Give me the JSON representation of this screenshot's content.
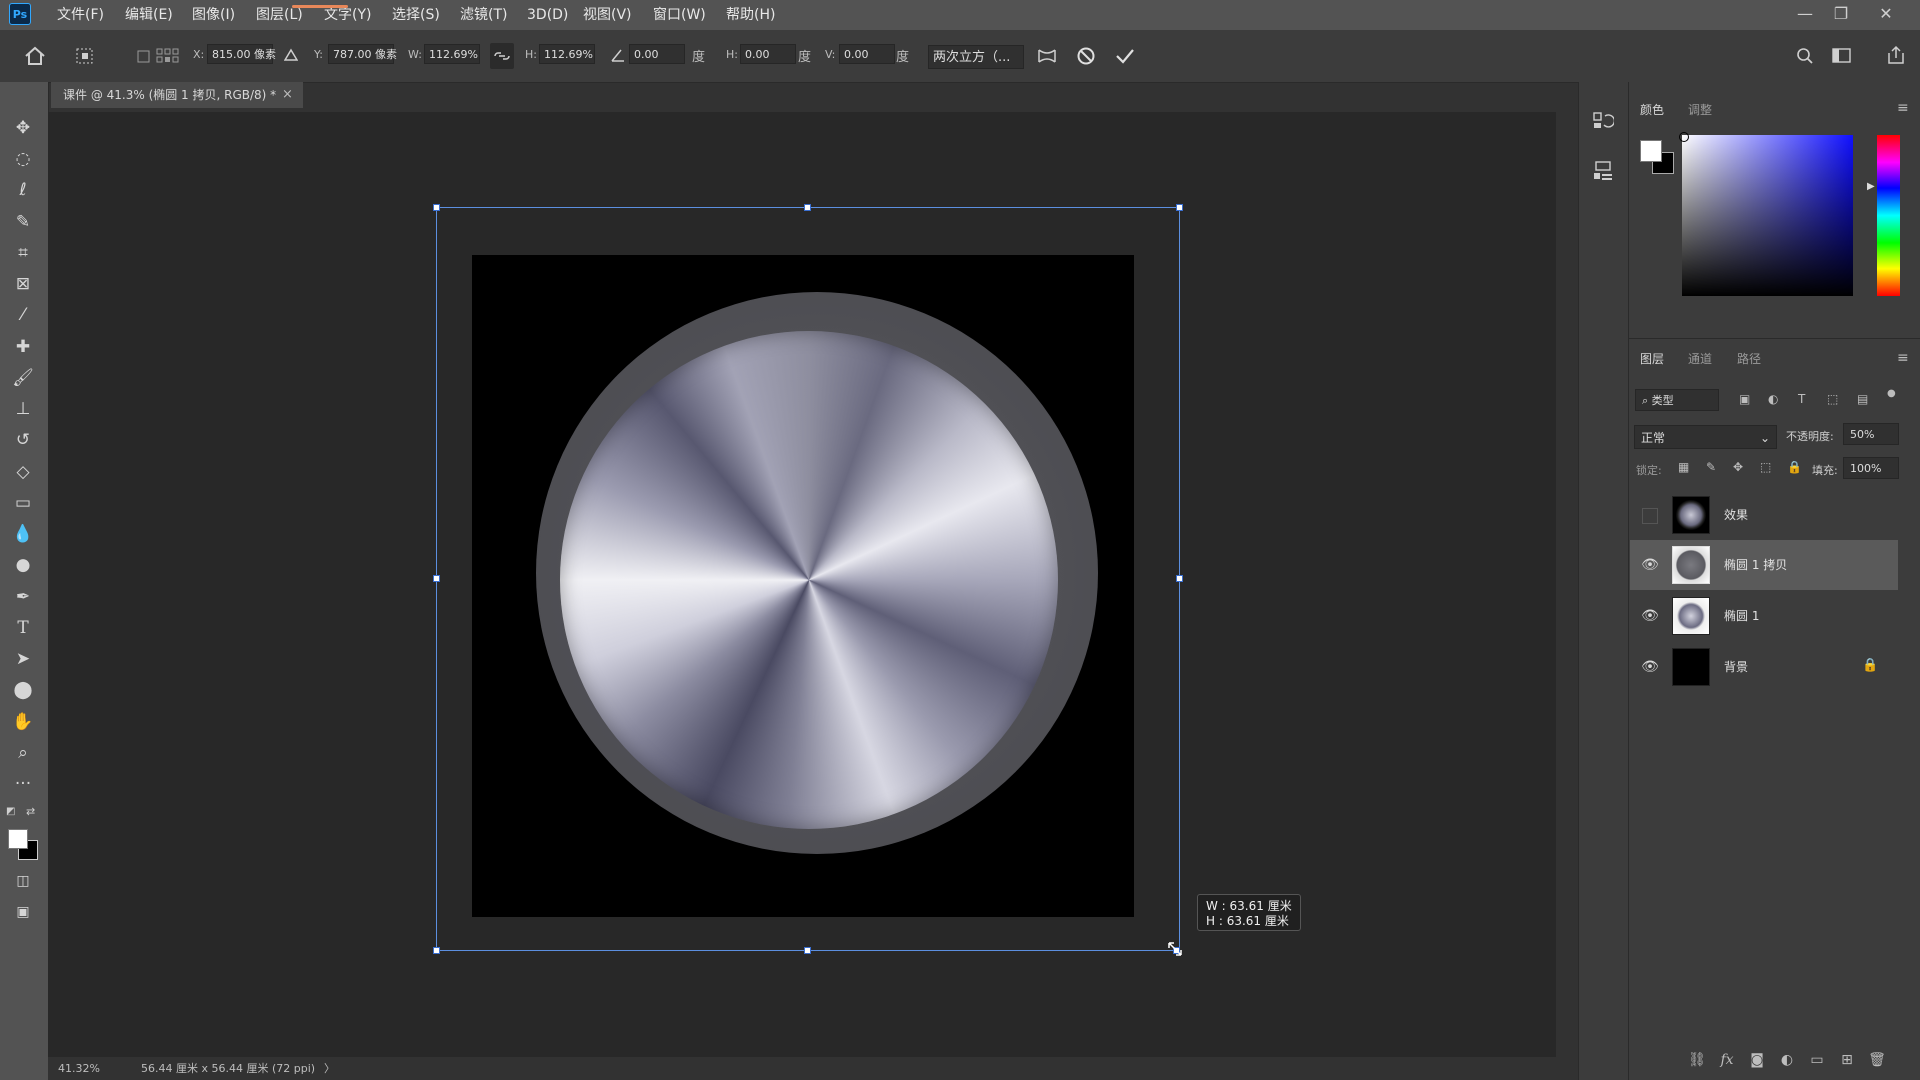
{
  "app": {
    "logo": "Ps"
  },
  "menu": [
    "文件(F)",
    "编辑(E)",
    "图像(I)",
    "图层(L)",
    "文字(Y)",
    "选择(S)",
    "滤镜(T)",
    "3D(D)",
    "视图(V)",
    "窗口(W)",
    "帮助(H)"
  ],
  "window_controls": {
    "minimize": "—",
    "restore": "❐",
    "close": "✕"
  },
  "options": {
    "x_label": "X:",
    "x_value": "815.00 像素",
    "y_label": "Y:",
    "y_value": "787.00 像素",
    "w_label": "W:",
    "w_value": "112.69%",
    "h_label": "H:",
    "h_value": "112.69%",
    "angle_value": "0.00",
    "angle_unit": "度",
    "hskew_label": "H:",
    "hskew_value": "0.00",
    "hskew_unit": "度",
    "vskew_label": "V:",
    "vskew_value": "0.00",
    "vskew_unit": "度",
    "interpolation": "两次立方（...",
    "icons": [
      "home-icon",
      "transform-icon",
      "link-icon",
      "warp-icon",
      "cancel-icon",
      "commit-icon",
      "search-icon",
      "workspace-icon",
      "share-icon"
    ]
  },
  "document": {
    "tab_title": "课件 @ 41.3% (椭圆 1 拷贝, RGB/8) *",
    "tab_close": "×",
    "size_tooltip_w": "W : 63.61 厘米",
    "size_tooltip_h": "H : 63.61 厘米"
  },
  "status": {
    "zoom": "41.32%",
    "doc_info": "56.44 厘米 x 56.44 厘米 (72 ppi)",
    "arrow": "〉"
  },
  "tools": [
    "move-tool",
    "elliptical-marquee-tool",
    "lasso-tool",
    "quick-selection-tool",
    "crop-tool",
    "frame-tool",
    "eyedropper-tool",
    "spot-healing-tool",
    "brush-tool",
    "clone-stamp-tool",
    "history-brush-tool",
    "eraser-tool",
    "gradient-tool",
    "blur-tool",
    "dodge-tool",
    "pen-tool",
    "type-tool",
    "path-selection-tool",
    "ellipse-tool",
    "hand-tool",
    "zoom-tool",
    "more-tools"
  ],
  "color_panel": {
    "tabs": [
      "颜色",
      "调整"
    ],
    "foreground": "#ffffff",
    "background": "#000000"
  },
  "layers_panel": {
    "tabs": [
      "图层",
      "通道",
      "路径"
    ],
    "filter_placeholder": "类型",
    "blend_mode": "正常",
    "opacity_label": "不透明度:",
    "opacity_value": "50%",
    "lock_label": "锁定:",
    "fill_label": "填充:",
    "fill_value": "100%",
    "layers": [
      {
        "name": "效果",
        "visible": false,
        "selected": false
      },
      {
        "name": "椭圆 1 拷贝",
        "visible": true,
        "selected": true
      },
      {
        "name": "椭圆 1",
        "visible": true,
        "selected": false
      },
      {
        "name": "背景",
        "visible": true,
        "selected": false,
        "locked": true
      }
    ]
  }
}
